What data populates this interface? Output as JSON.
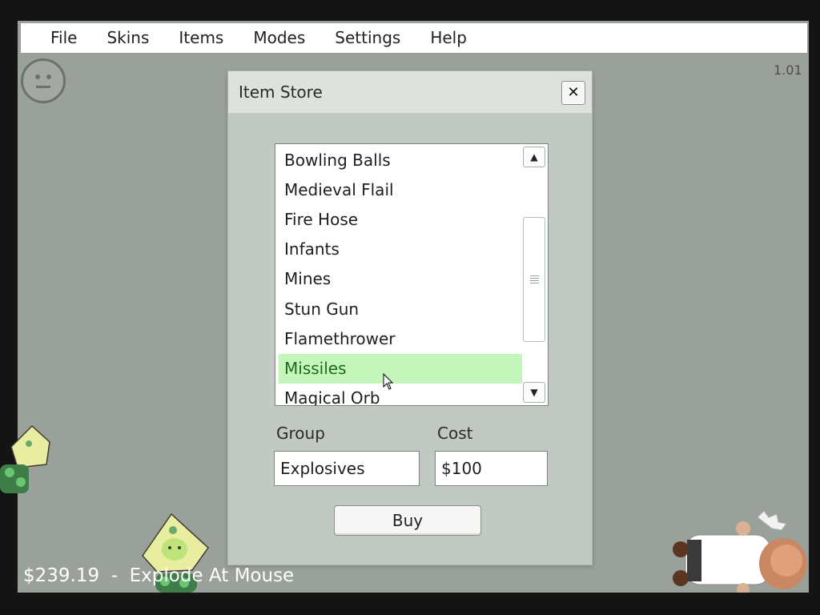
{
  "menubar": {
    "items": [
      "File",
      "Skins",
      "Items",
      "Modes",
      "Settings",
      "Help"
    ]
  },
  "version": "1.01",
  "status": "$239.19  -  Explode At Mouse",
  "dialog": {
    "title": "Item Store",
    "close_glyph": "✕",
    "items": [
      "Bowling Balls",
      "Medieval Flail",
      "Fire Hose",
      "Infants",
      "Mines",
      "Stun Gun",
      "Flamethrower",
      "Missiles",
      "Magical Orb"
    ],
    "selected_item": "Missiles",
    "group_label": "Group",
    "group_value": "Explosives",
    "cost_label": "Cost",
    "cost_value": "$100",
    "buy_label": "Buy"
  },
  "colors": {
    "game_bg": "#9aa19a",
    "selection": "#c4f6bb",
    "selection_text": "#1a6a1a"
  }
}
